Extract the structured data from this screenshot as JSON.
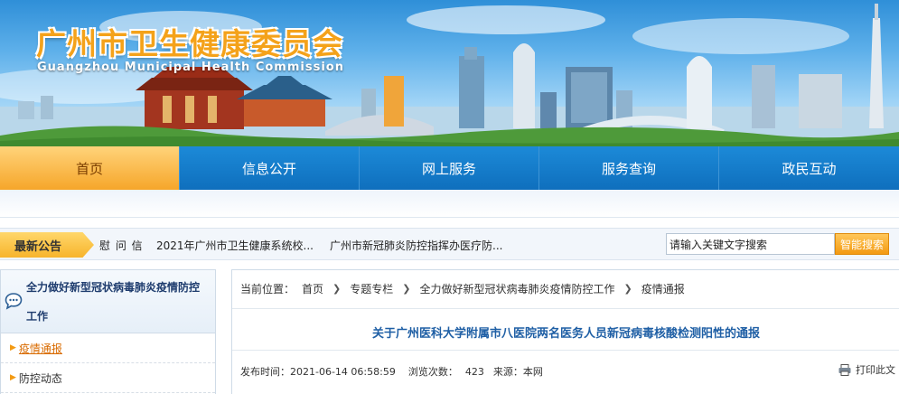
{
  "header": {
    "title": "广州市卫生健康委员会",
    "subtitle": "Guangzhou Municipal Health Commission"
  },
  "nav": {
    "items": [
      {
        "label": "首页",
        "active": true
      },
      {
        "label": "信息公开",
        "active": false
      },
      {
        "label": "网上服务",
        "active": false
      },
      {
        "label": "服务查询",
        "active": false
      },
      {
        "label": "政民互动",
        "active": false
      }
    ]
  },
  "notice": {
    "label": "最新公告",
    "items": [
      "慰 问 信",
      "2021年广州市卫生健康系统校...",
      "广州市新冠肺炎防控指挥办医疗防..."
    ]
  },
  "search": {
    "placeholder": "请输入关键文字搜索",
    "button_label": "智能搜索"
  },
  "sidebar": {
    "heading_line1": "全力做好新型冠状病毒肺炎疫情防控",
    "heading_line2": "工作",
    "items": [
      {
        "label": "疫情通报",
        "active": true
      },
      {
        "label": "防控动态",
        "active": false
      }
    ]
  },
  "breadcrumb": {
    "prefix": "当前位置：",
    "items": [
      "首页",
      "专题专栏",
      "全力做好新型冠状病毒肺炎疫情防控工作",
      "疫情通报"
    ]
  },
  "article": {
    "title": "关于广州医科大学附属市八医院两名医务人员新冠病毒核酸检测阳性的通报",
    "published_label": "发布时间：",
    "published_value": "2021-06-14 06:58:59",
    "views_label": "浏览次数：",
    "views_value": "423",
    "source_label": "来源：",
    "source_value": "本网",
    "print_label": "打印此文"
  },
  "colors": {
    "nav_blue": "#1c8ad8",
    "accent_orange": "#f39a12",
    "title_orange": "#f4a21a",
    "link_blue": "#1f5fa5"
  }
}
